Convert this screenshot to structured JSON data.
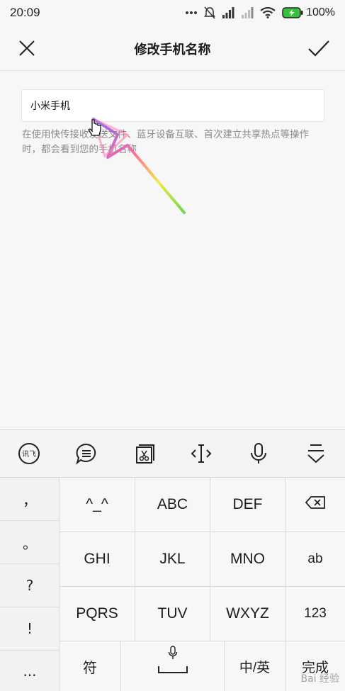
{
  "status_bar": {
    "time": "20:09",
    "battery_percent": "100%",
    "icons": [
      "more-dots-icon",
      "mute-bell-icon",
      "signal-icon",
      "signal-icon",
      "wifi-icon",
      "battery-charging-icon"
    ]
  },
  "header": {
    "title": "修改手机名称",
    "close_icon": "close-icon",
    "confirm_icon": "checkmark-icon"
  },
  "form": {
    "device_name_value": "小米手机",
    "hint": "在使用快传接收发送文件、蓝牙设备互联、首次建立共享热点等操作时，都会看到您的手机名称"
  },
  "keyboard_toolbar": {
    "icons": [
      "ifly-logo-icon",
      "speech-bubble-icon",
      "clipboard-scissors-icon",
      "cursor-move-icon",
      "microphone-icon",
      "hide-keyboard-icon"
    ],
    "logo_text": "讯飞"
  },
  "keyboard": {
    "symbols": [
      "，",
      "。",
      "?",
      "!",
      "..."
    ],
    "rows": [
      [
        "^_^",
        "ABC",
        "DEF"
      ],
      [
        "GHI",
        "JKL",
        "MNO"
      ],
      [
        "PQRS",
        "TUV",
        "WXYZ"
      ]
    ],
    "right_keys": [
      "ab",
      "123"
    ],
    "bottom": {
      "symbol_key": "符",
      "chinese_key": "中/英",
      "done_key": "完成"
    }
  },
  "watermark": "Bai 经验"
}
